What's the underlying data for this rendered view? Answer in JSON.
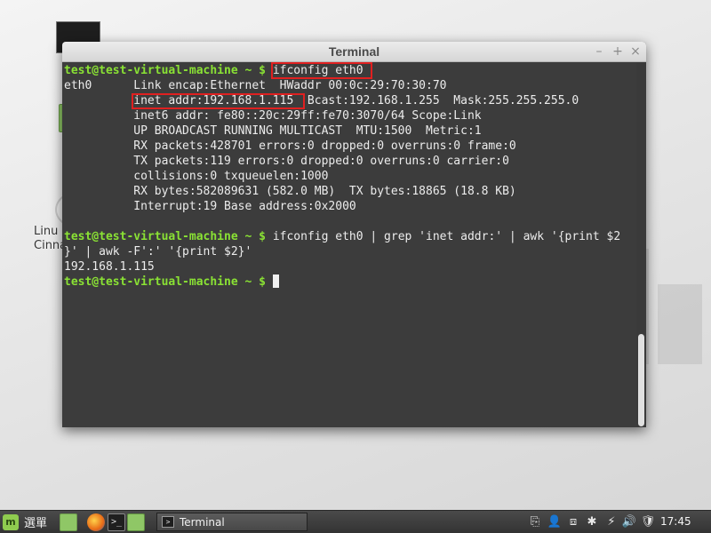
{
  "desktop": {
    "icon_label_lines": [
      "Linu",
      "Cinna"
    ]
  },
  "window": {
    "title": "Terminal",
    "minimize_glyph": "–",
    "maximize_glyph": "+",
    "close_glyph": "×"
  },
  "terminal": {
    "prompt": "test@test-virtual-machine ~ $",
    "cmd1": "ifconfig eth0",
    "output": {
      "l1": "eth0      Link encap:Ethernet  HWaddr 00:0c:29:70:30:70",
      "l2": "          inet addr:192.168.1.115  Bcast:192.168.1.255  Mask:255.255.255.0",
      "l3": "          inet6 addr: fe80::20c:29ff:fe70:3070/64 Scope:Link",
      "l4": "          UP BROADCAST RUNNING MULTICAST  MTU:1500  Metric:1",
      "l5": "          RX packets:428701 errors:0 dropped:0 overruns:0 frame:0",
      "l6": "          TX packets:119 errors:0 dropped:0 overruns:0 carrier:0",
      "l7": "          collisions:0 txqueuelen:1000",
      "l8": "          RX bytes:582089631 (582.0 MB)  TX bytes:18865 (18.8 KB)",
      "l9": "          Interrupt:19 Base address:0x2000"
    },
    "cmd2_part1": "ifconfig eth0 | grep 'inet addr:' | awk '{print $2",
    "cmd2_part2": "}' | awk -F':' '{print $2}'",
    "result": "192.168.1.115"
  },
  "panel": {
    "menu_label": "選單",
    "task_label": "Terminal",
    "clock": "17:45",
    "accent_color": "#8ae234",
    "highlight_color": "#e02020"
  }
}
